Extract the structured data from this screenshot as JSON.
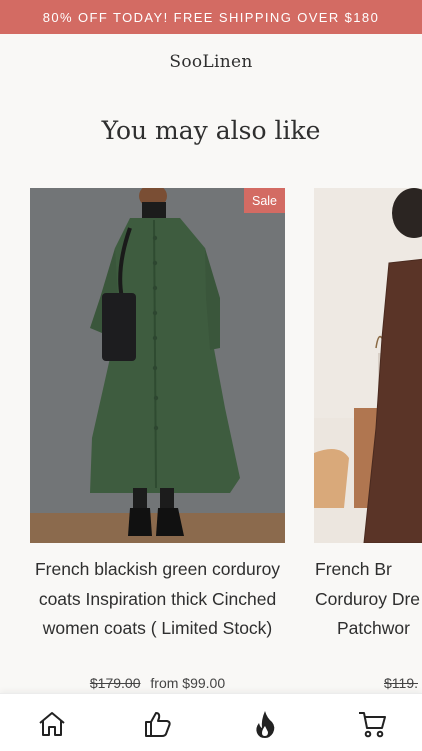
{
  "promo": {
    "text": "80% OFF TODAY! FREE SHIPPING OVER $180"
  },
  "brand": {
    "name": "SooLinen"
  },
  "section": {
    "title": "You may also like"
  },
  "products": [
    {
      "badge": "Sale",
      "title": "French blackish green corduroy coats Inspiration thick Cinched women coats ( Limited Stock)",
      "compare_price": "$179.00",
      "price": "from $99.00"
    },
    {
      "title_lines": [
        "French Br",
        "Corduroy Dre",
        "Patchwor"
      ],
      "compare_price": "$119."
    }
  ],
  "nav": {
    "items": [
      {
        "icon": "home-icon"
      },
      {
        "icon": "thumbs-up-icon"
      },
      {
        "icon": "flame-icon"
      },
      {
        "icon": "cart-icon"
      }
    ]
  },
  "colors": {
    "accent": "#d36b63",
    "background": "#f9f8f6"
  }
}
